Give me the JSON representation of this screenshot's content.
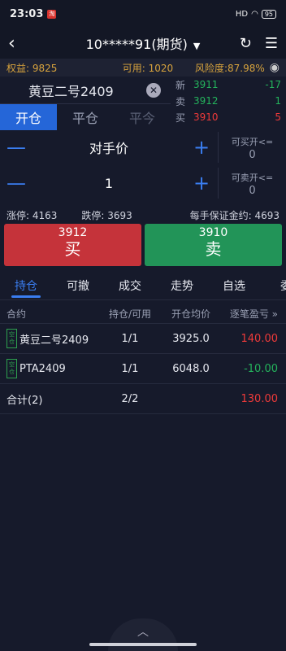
{
  "status": {
    "time": "23:03",
    "notif_badge": "淘",
    "signal": "HD",
    "battery": "95"
  },
  "header": {
    "title": "10*****91(期货)",
    "caret": "▼"
  },
  "info": {
    "equity": "权益: 9825",
    "available": "可用: 1020",
    "risk": "风险度:87.98%"
  },
  "product": {
    "name": "黄豆二号2409"
  },
  "quote": [
    {
      "label": "新",
      "price": "3911",
      "change": "-17",
      "price_color": "green",
      "change_color": "green"
    },
    {
      "label": "卖",
      "price": "3912",
      "change": "1",
      "price_color": "green",
      "change_color": "green"
    },
    {
      "label": "买",
      "price": "3910",
      "change": "5",
      "price_color": "red",
      "change_color": "red"
    }
  ],
  "ops_tabs": [
    "开仓",
    "平仓",
    "平今"
  ],
  "price_type": "对手价",
  "quantity": "1",
  "avail_buy": {
    "label": "可买开<=",
    "value": "0"
  },
  "avail_sell": {
    "label": "可卖开<=",
    "value": "0"
  },
  "limits": {
    "up": "涨停: 4163",
    "down": "跌停: 3693",
    "margin": "每手保证金约: 4693"
  },
  "buy": {
    "price": "3912",
    "label": "买"
  },
  "sell": {
    "price": "3910",
    "label": "卖"
  },
  "tabs2": [
    "持仓",
    "可撤",
    "成交",
    "走势",
    "自选",
    "委"
  ],
  "positions": {
    "headers": [
      "合约",
      "持仓/可用",
      "开仓均价",
      "逐笔盈亏 »"
    ],
    "rows": [
      {
        "tag": "空仓",
        "name": "黄豆二号2409",
        "qty": "1/1",
        "avg": "3925.0",
        "pnl": "140.00",
        "pnl_color": "red"
      },
      {
        "tag": "空仓",
        "name": "PTA2409",
        "qty": "1/1",
        "avg": "6048.0",
        "pnl": "-10.00",
        "pnl_color": "green"
      }
    ],
    "total": {
      "label": "合计(2)",
      "qty": "2/2",
      "pnl": "130.00"
    }
  },
  "colors": {
    "accent": "#3a7df0",
    "buy": "#c5333a",
    "sell": "#229458",
    "warn": "#d7a33d"
  }
}
